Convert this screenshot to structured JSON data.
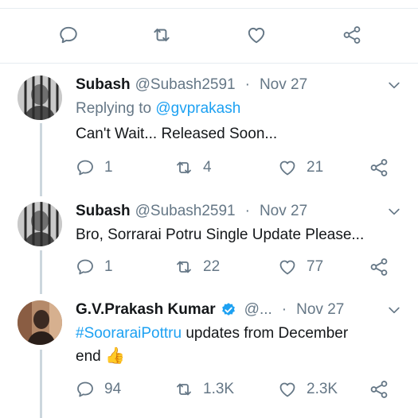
{
  "top_actions": {
    "reply_icon": "reply-icon",
    "retweet_icon": "retweet-icon",
    "like_icon": "heart-icon",
    "share_icon": "share-icon"
  },
  "tweets": [
    {
      "name": "Subash",
      "handle": "@Subash2591",
      "separator": "·",
      "date": "Nov 27",
      "replying_prefix": "Replying to",
      "replying_to": "@gvprakash",
      "text": "Can't Wait... Released Soon...",
      "replies": "1",
      "retweets": "4",
      "likes": "21"
    },
    {
      "name": "Subash",
      "handle": "@Subash2591",
      "separator": "·",
      "date": "Nov 27",
      "text": "Bro, Sorrarai Potru Single Update Please...",
      "replies": "1",
      "retweets": "22",
      "likes": "77"
    },
    {
      "name": "G.V.Prakash Kumar",
      "verified": true,
      "handle": "@...",
      "separator": "·",
      "date": "Nov 27",
      "hashtag": "#SooraraiPottru",
      "text_rest": " updates from December",
      "text_line2": "end",
      "emoji": "👍",
      "replies": "94",
      "retweets": "1.3K",
      "likes": "2.3K"
    }
  ],
  "colors": {
    "link": "#1da1f2",
    "secondary": "#657786",
    "divider": "#e6ecf0",
    "thread_line": "#ccd6dd"
  }
}
